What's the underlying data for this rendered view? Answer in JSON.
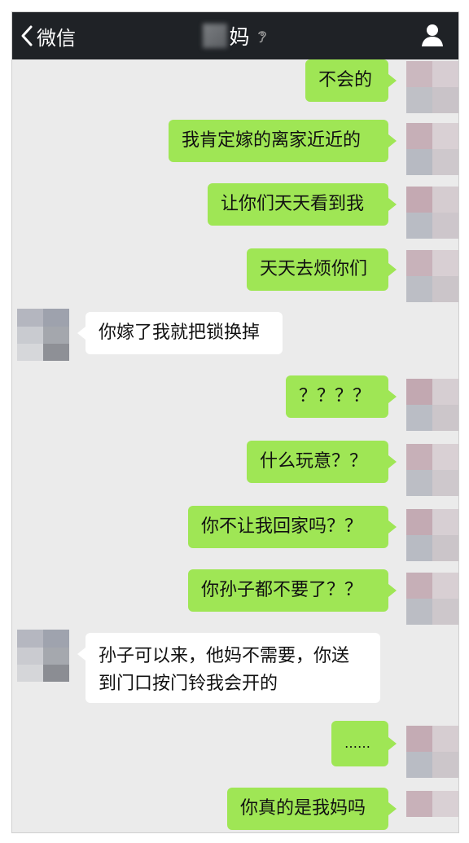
{
  "header": {
    "back_label": "微信",
    "title": "妈",
    "icons": {
      "back": "chevron-left-icon",
      "mute": "ear-muted-icon",
      "profile": "person-icon"
    }
  },
  "colors": {
    "header_bg": "#1f2226",
    "chat_bg": "#ebebeb",
    "outgoing_bubble": "#9fe655",
    "incoming_bubble": "#ffffff"
  },
  "messages": [
    {
      "side": "right",
      "text": "不会的"
    },
    {
      "side": "right",
      "text": "我肯定嫁的离家近近的"
    },
    {
      "side": "right",
      "text": "让你们天天看到我"
    },
    {
      "side": "right",
      "text": "天天去烦你们"
    },
    {
      "side": "left",
      "text": "你嫁了我就把锁换掉"
    },
    {
      "side": "right",
      "text": "？？？？"
    },
    {
      "side": "right",
      "text": "什么玩意？？"
    },
    {
      "side": "right",
      "text": "你不让我回家吗？？"
    },
    {
      "side": "right",
      "text": "你孙子都不要了？？"
    },
    {
      "side": "left",
      "text": "孙子可以来，他妈不需要，你送",
      "text_line2": "到门口按门铃我会开的"
    },
    {
      "side": "right",
      "text": "……"
    },
    {
      "side": "right",
      "text": "你真的是我妈吗"
    }
  ]
}
